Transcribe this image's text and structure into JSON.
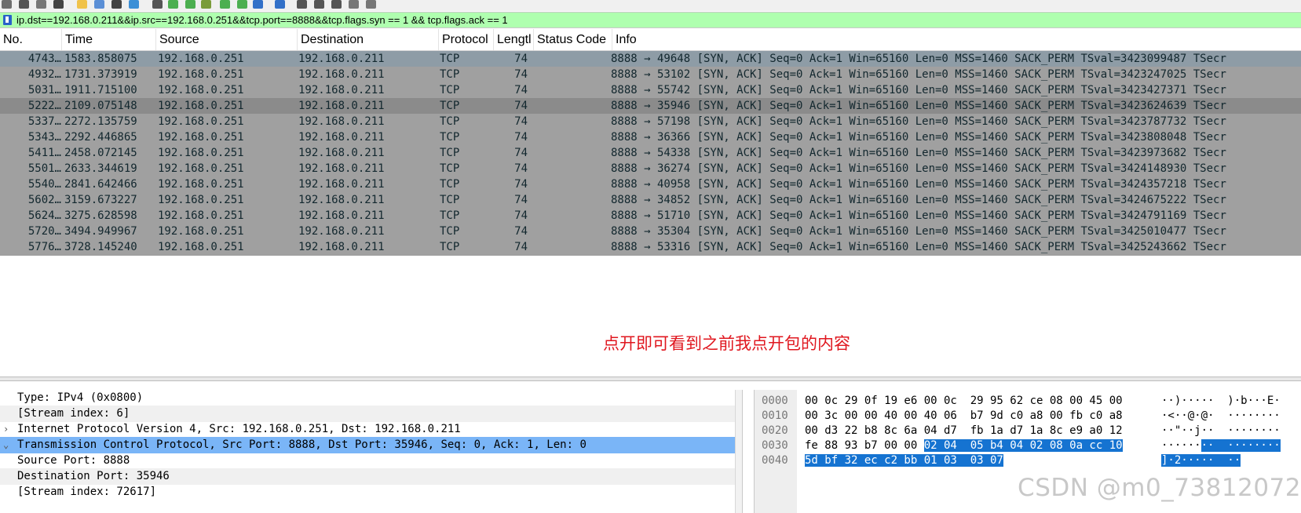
{
  "toolbar": {
    "icons": [
      "shark-fin-icon",
      "stop-icon",
      "restart-icon",
      "options-icon",
      "open-folder-icon",
      "save-icon",
      "close-file-icon",
      "reload-icon",
      "find-icon",
      "back-icon",
      "forward-icon",
      "go-to-packet-icon",
      "first-packet-icon",
      "last-packet-icon",
      "autoscroll-icon",
      "colorize-icon",
      "zoom-in-icon",
      "zoom-out-icon",
      "normal-size-icon",
      "resize-columns-icon",
      "layout-icon"
    ]
  },
  "filter": {
    "text": "ip.dst==192.168.0.211&&ip.src==192.168.0.251&&tcp.port==8888&&tcp.flags.syn == 1 && tcp.flags.ack == 1"
  },
  "columns": {
    "no": "No.",
    "time": "Time",
    "source": "Source",
    "destination": "Destination",
    "protocol": "Protocol",
    "length": "Lengtl",
    "status": "Status Code",
    "info": "Info"
  },
  "packets": [
    {
      "no": "4743…",
      "time": "1583.858075",
      "src": "192.168.0.251",
      "dst": "192.168.0.211",
      "proto": "TCP",
      "len": "74",
      "status": "",
      "info": "8888 → 49648 [SYN, ACK] Seq=0 Ack=1 Win=65160 Len=0 MSS=1460 SACK_PERM TSval=3423099487 TSecr"
    },
    {
      "no": "4932…",
      "time": "1731.373919",
      "src": "192.168.0.251",
      "dst": "192.168.0.211",
      "proto": "TCP",
      "len": "74",
      "status": "",
      "info": "8888 → 53102 [SYN, ACK] Seq=0 Ack=1 Win=65160 Len=0 MSS=1460 SACK_PERM TSval=3423247025 TSecr"
    },
    {
      "no": "5031…",
      "time": "1911.715100",
      "src": "192.168.0.251",
      "dst": "192.168.0.211",
      "proto": "TCP",
      "len": "74",
      "status": "",
      "info": "8888 → 55742 [SYN, ACK] Seq=0 Ack=1 Win=65160 Len=0 MSS=1460 SACK_PERM TSval=3423427371 TSecr"
    },
    {
      "no": "5222…",
      "time": "2109.075148",
      "src": "192.168.0.251",
      "dst": "192.168.0.211",
      "proto": "TCP",
      "len": "74",
      "status": "",
      "info": "8888 → 35946 [SYN, ACK] Seq=0 Ack=1 Win=65160 Len=0 MSS=1460 SACK_PERM TSval=3423624639 TSecr"
    },
    {
      "no": "5337…",
      "time": "2272.135759",
      "src": "192.168.0.251",
      "dst": "192.168.0.211",
      "proto": "TCP",
      "len": "74",
      "status": "",
      "info": "8888 → 57198 [SYN, ACK] Seq=0 Ack=1 Win=65160 Len=0 MSS=1460 SACK_PERM TSval=3423787732 TSecr"
    },
    {
      "no": "5343…",
      "time": "2292.446865",
      "src": "192.168.0.251",
      "dst": "192.168.0.211",
      "proto": "TCP",
      "len": "74",
      "status": "",
      "info": "8888 → 36366 [SYN, ACK] Seq=0 Ack=1 Win=65160 Len=0 MSS=1460 SACK_PERM TSval=3423808048 TSecr"
    },
    {
      "no": "5411…",
      "time": "2458.072145",
      "src": "192.168.0.251",
      "dst": "192.168.0.211",
      "proto": "TCP",
      "len": "74",
      "status": "",
      "info": "8888 → 54338 [SYN, ACK] Seq=0 Ack=1 Win=65160 Len=0 MSS=1460 SACK_PERM TSval=3423973682 TSecr"
    },
    {
      "no": "5501…",
      "time": "2633.344619",
      "src": "192.168.0.251",
      "dst": "192.168.0.211",
      "proto": "TCP",
      "len": "74",
      "status": "",
      "info": "8888 → 36274 [SYN, ACK] Seq=0 Ack=1 Win=65160 Len=0 MSS=1460 SACK_PERM TSval=3424148930 TSecr"
    },
    {
      "no": "5540…",
      "time": "2841.642466",
      "src": "192.168.0.251",
      "dst": "192.168.0.211",
      "proto": "TCP",
      "len": "74",
      "status": "",
      "info": "8888 → 40958 [SYN, ACK] Seq=0 Ack=1 Win=65160 Len=0 MSS=1460 SACK_PERM TSval=3424357218 TSecr"
    },
    {
      "no": "5602…",
      "time": "3159.673227",
      "src": "192.168.0.251",
      "dst": "192.168.0.211",
      "proto": "TCP",
      "len": "74",
      "status": "",
      "info": "8888 → 34852 [SYN, ACK] Seq=0 Ack=1 Win=65160 Len=0 MSS=1460 SACK_PERM TSval=3424675222 TSecr"
    },
    {
      "no": "5624…",
      "time": "3275.628598",
      "src": "192.168.0.251",
      "dst": "192.168.0.211",
      "proto": "TCP",
      "len": "74",
      "status": "",
      "info": "8888 → 51710 [SYN, ACK] Seq=0 Ack=1 Win=65160 Len=0 MSS=1460 SACK_PERM TSval=3424791169 TSecr"
    },
    {
      "no": "5720…",
      "time": "3494.949967",
      "src": "192.168.0.251",
      "dst": "192.168.0.211",
      "proto": "TCP",
      "len": "74",
      "status": "",
      "info": "8888 → 35304 [SYN, ACK] Seq=0 Ack=1 Win=65160 Len=0 MSS=1460 SACK_PERM TSval=3425010477 TSecr"
    },
    {
      "no": "5776…",
      "time": "3728.145240",
      "src": "192.168.0.251",
      "dst": "192.168.0.211",
      "proto": "TCP",
      "len": "74",
      "status": "",
      "info": "8888 → 53316 [SYN, ACK] Seq=0 Ack=1 Win=65160 Len=0 MSS=1460 SACK_PERM TSval=3425243662 TSecr"
    }
  ],
  "selected_row": 3,
  "annotation": "点开即可看到之前我点开包的内容",
  "details": [
    {
      "arrow": "",
      "text": "    Type: IPv4 (0x0800)"
    },
    {
      "arrow": "",
      "text": "    [Stream index: 6]"
    },
    {
      "arrow": "›",
      "text": "Internet Protocol Version 4, Src: 192.168.0.251, Dst: 192.168.0.211"
    },
    {
      "arrow": "⌄",
      "text": "Transmission Control Protocol, Src Port: 8888, Dst Port: 35946, Seq: 0, Ack: 1, Len: 0"
    },
    {
      "arrow": "",
      "text": "    Source Port: 8888"
    },
    {
      "arrow": "",
      "text": "    Destination Port: 35946"
    },
    {
      "arrow": "",
      "text": "    [Stream index: 72617]"
    }
  ],
  "bytes": [
    {
      "offset": "0000",
      "hex": "00 0c 29 0f 19 e6 00 0c  29 95 62 ce 08 00 45 00",
      "hex_sel": "",
      "ascii": "··)·····  )·b···E·",
      "ascii_sel": ""
    },
    {
      "offset": "0010",
      "hex": "00 3c 00 00 40 00 40 06  b7 9d c0 a8 00 fb c0 a8",
      "hex_sel": "",
      "ascii": "·<··@·@·  ········",
      "ascii_sel": ""
    },
    {
      "offset": "0020",
      "hex": "00 d3 22 b8 8c 6a 04 d7  fb 1a d7 1a 8c e9 a0 12",
      "hex_sel": "",
      "ascii": "··\"··j··  ········",
      "ascii_sel": ""
    },
    {
      "offset": "0030",
      "hex": "fe 88 93 b7 00 00 ",
      "hex_sel": "02 04  05 b4 04 02 08 0a cc 10",
      "ascii": "······",
      "ascii_sel": "··  ········"
    },
    {
      "offset": "0040",
      "hex": "",
      "hex_sel": "5d bf 32 ec c2 bb 01 03  03 07",
      "ascii": "",
      "ascii_sel": "]·2·····  ··"
    }
  ],
  "watermark": "CSDN @m0_73812072"
}
